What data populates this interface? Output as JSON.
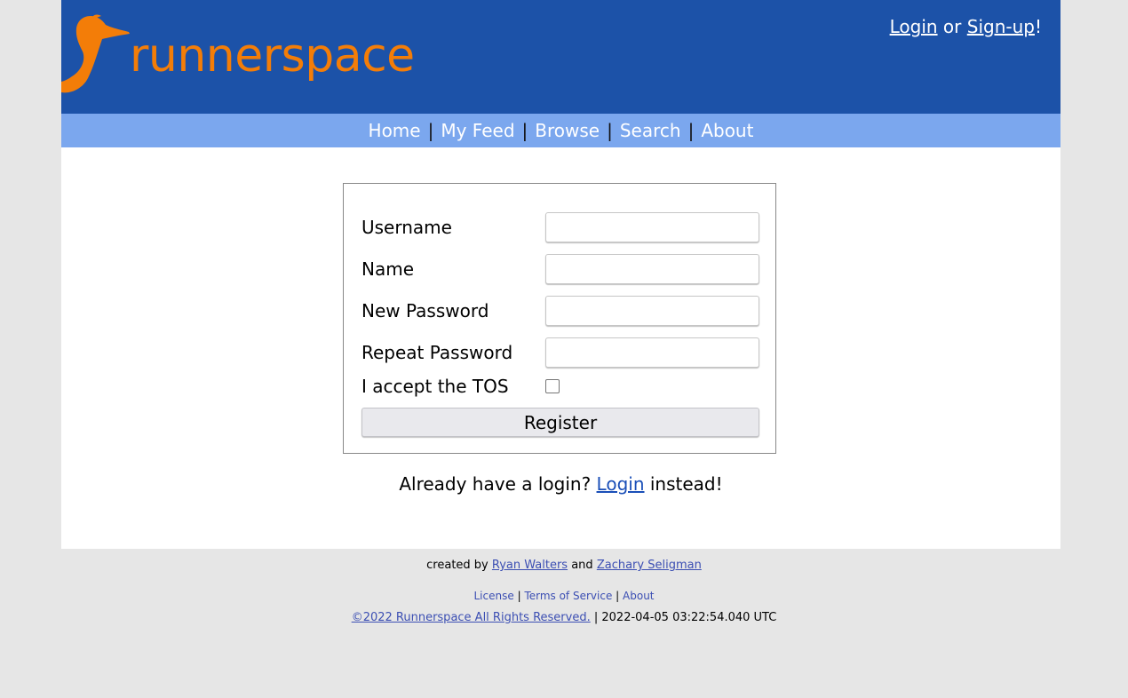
{
  "header": {
    "logo_text": "runnerspace",
    "login_label": "Login",
    "or_text": "or",
    "signup_label": "Sign-up",
    "exclaim": "!",
    "brand_color": "#1c52a8",
    "logo_color": "#f37d08"
  },
  "nav": {
    "items": [
      "Home",
      "My Feed",
      "Browse",
      "Search",
      "About"
    ],
    "separator": "|",
    "bar_color": "#7ba7ee"
  },
  "form": {
    "fields": [
      {
        "label": "Username",
        "value": ""
      },
      {
        "label": "Name",
        "value": ""
      },
      {
        "label": "New Password",
        "value": ""
      },
      {
        "label": "Repeat Password",
        "value": ""
      }
    ],
    "tos_label": "I accept the TOS",
    "tos_checked": false,
    "register_label": "Register"
  },
  "login_prompt": {
    "before": "Already have a login?",
    "link": "Login",
    "after": "instead!"
  },
  "footer": {
    "created_by": "created by",
    "author1": "Ryan Walters",
    "and_text": "and",
    "author2": "Zachary Seligman",
    "links": [
      "License",
      "Terms of Service",
      "About"
    ],
    "link_separator": "|",
    "copyright": "©2022 Runnerspace All Rights Reserved.",
    "timestamp": "2022-04-05 03:22:54.040 UTC"
  }
}
